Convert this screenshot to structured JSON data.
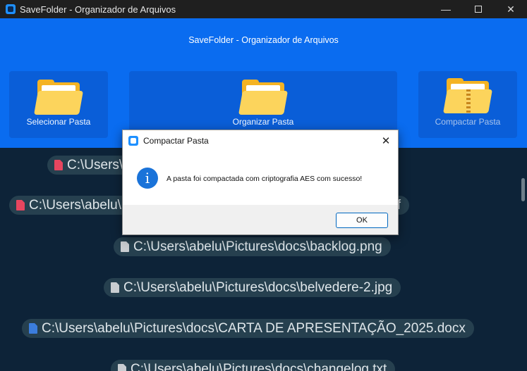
{
  "window": {
    "title": "SaveFolder - Organizador de Arquivos"
  },
  "header": {
    "title": "SaveFolder - Organizador de Arquivos",
    "tiles": {
      "select": {
        "label": "Selecionar Pasta"
      },
      "organize": {
        "label": "Organizar Pasta"
      },
      "compress": {
        "label": "Compactar Pasta"
      }
    }
  },
  "files": [
    {
      "path": "C:\\Users\\abelu\\Pictures\\docs\\Aula de SGBD.pdf",
      "type": "pdf"
    },
    {
      "path": "C:\\Users\\abelu\\Pictures\\docs\\Empreendedores Inovadores.pdf",
      "type": "pdf"
    },
    {
      "path": "C:\\Users\\abelu\\Pictures\\docs\\backlog.png",
      "type": "image"
    },
    {
      "path": "C:\\Users\\abelu\\Pictures\\docs\\belvedere-2.jpg",
      "type": "image"
    },
    {
      "path": "C:\\Users\\abelu\\Pictures\\docs\\CARTA DE APRESENTAÇÃO_2025.docx",
      "type": "word"
    },
    {
      "path": "C:\\Users\\abelu\\Pictures\\docs\\changelog.txt",
      "type": "text"
    }
  ],
  "dialog": {
    "title": "Compactar Pasta",
    "message": "A pasta foi compactada com criptografia AES com sucesso!",
    "ok_label": "OK"
  },
  "colors": {
    "header_bg": "#0a6cf0",
    "tile_bg": "#0a5ed8",
    "list_bg": "#0d2338",
    "pill_bg": "#26404f",
    "pdf_icon": "#e7465f",
    "word_icon": "#3b7ddd"
  }
}
